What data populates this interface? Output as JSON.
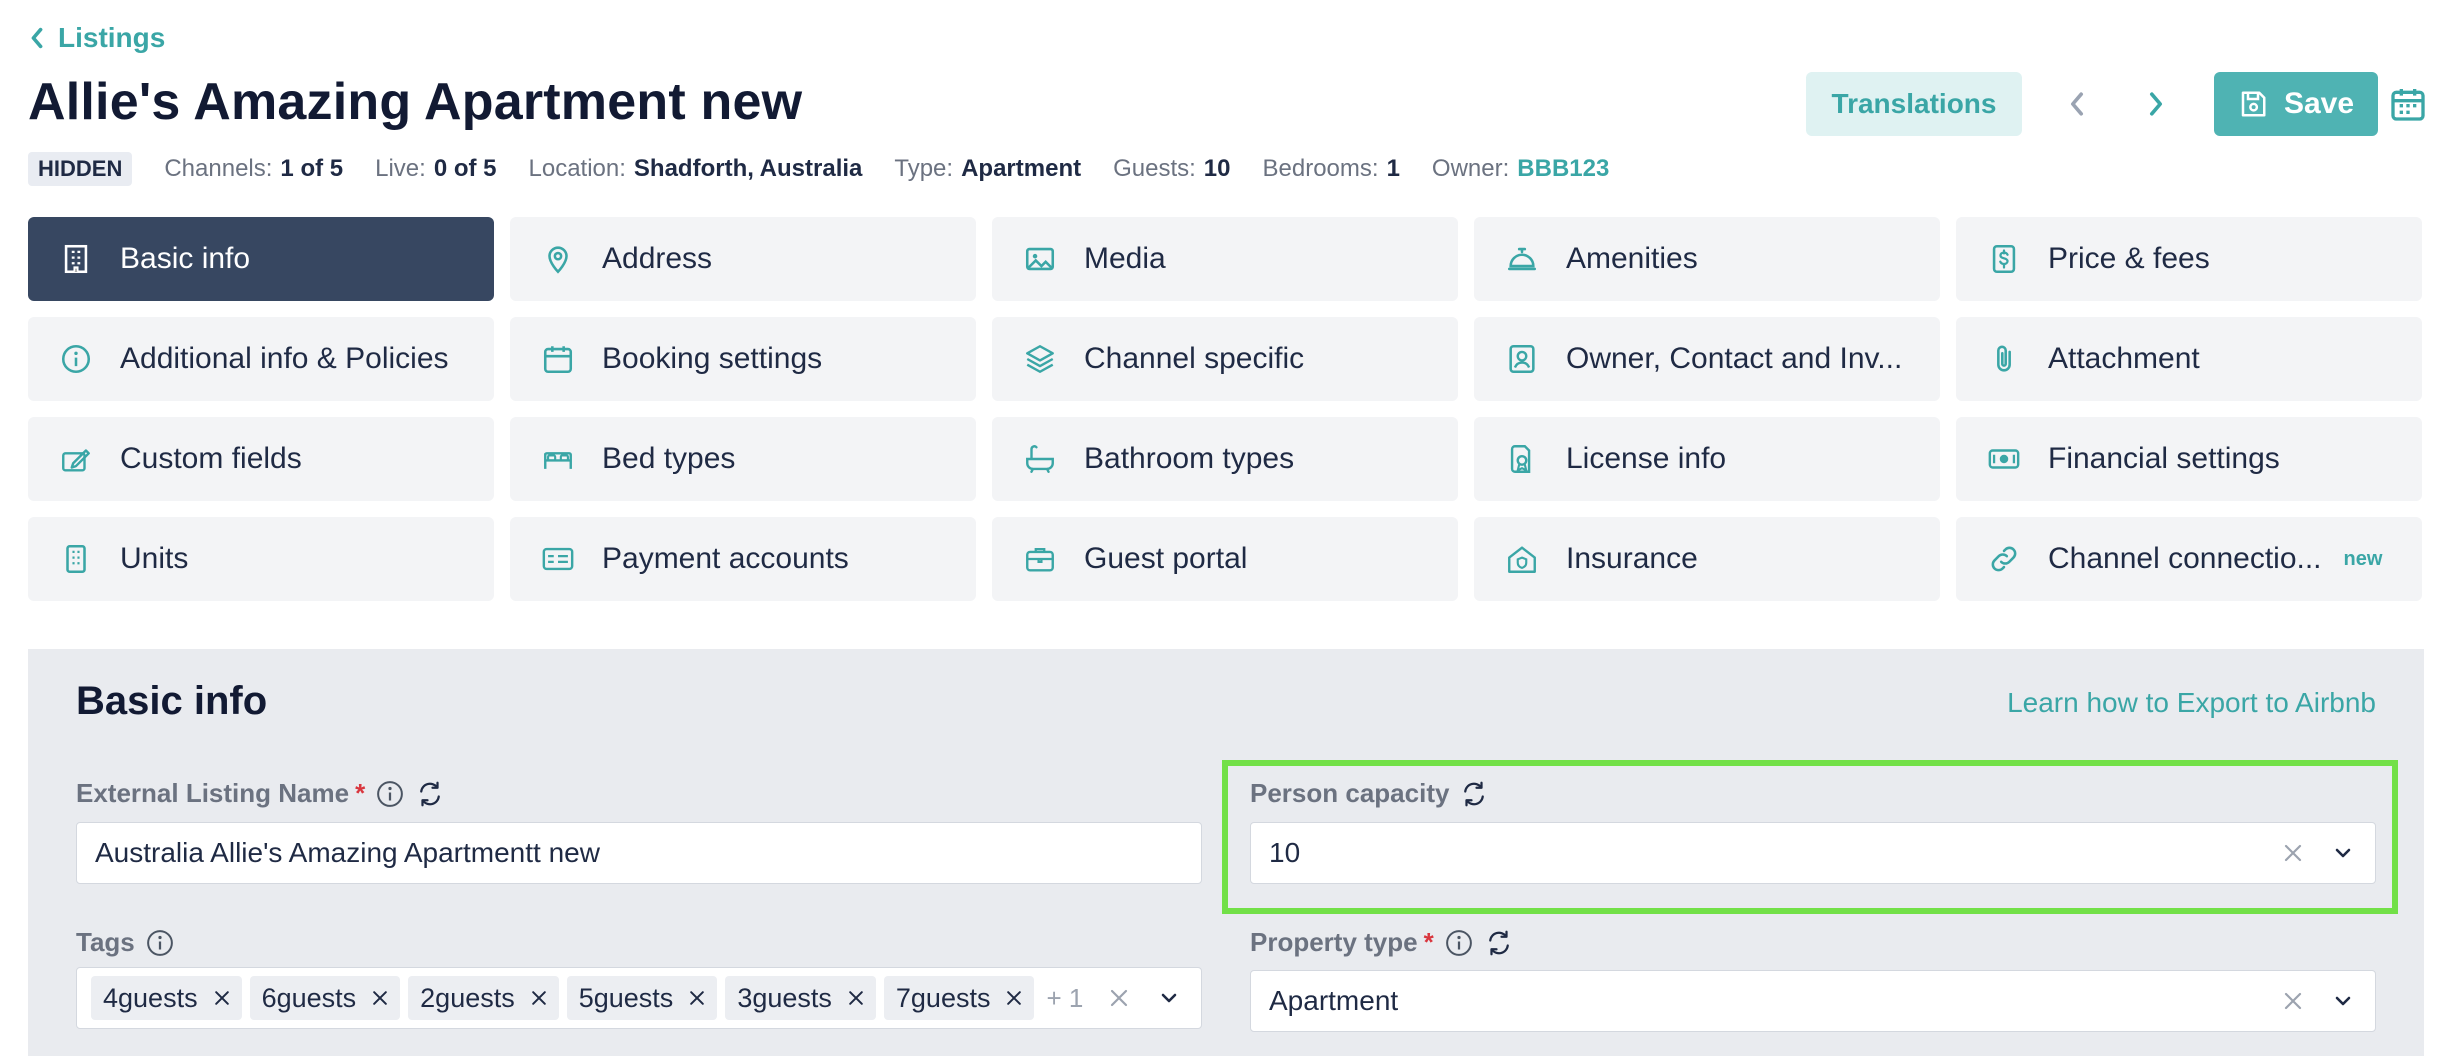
{
  "header": {
    "back_label": "Listings",
    "title": "Allie's Amazing Apartment new",
    "status_badge": "HIDDEN",
    "meta": {
      "channels_label": "Channels:",
      "channels_value": "1 of 5",
      "live_label": "Live:",
      "live_value": "0 of 5",
      "location_label": "Location:",
      "location_value": "Shadforth, Australia",
      "type_label": "Type:",
      "type_value": "Apartment",
      "guests_label": "Guests:",
      "guests_value": "10",
      "bedrooms_label": "Bedrooms:",
      "bedrooms_value": "1",
      "owner_label": "Owner:",
      "owner_value": "BBB123"
    },
    "translations_label": "Translations",
    "save_label": "Save"
  },
  "tabs": [
    {
      "label": "Basic info",
      "icon": "building-icon",
      "active": true
    },
    {
      "label": "Address",
      "icon": "map-pin-icon"
    },
    {
      "label": "Media",
      "icon": "image-icon"
    },
    {
      "label": "Amenities",
      "icon": "service-bell-icon"
    },
    {
      "label": "Price & fees",
      "icon": "dollar-icon"
    },
    {
      "label": "Additional info & Policies",
      "icon": "info-icon"
    },
    {
      "label": "Booking settings",
      "icon": "calendar-icon"
    },
    {
      "label": "Channel specific",
      "icon": "layers-icon"
    },
    {
      "label": "Owner, Contact and Inv...",
      "icon": "contact-icon"
    },
    {
      "label": "Attachment",
      "icon": "paperclip-icon"
    },
    {
      "label": "Custom fields",
      "icon": "edit-icon"
    },
    {
      "label": "Bed types",
      "icon": "bed-icon"
    },
    {
      "label": "Bathroom types",
      "icon": "bathtub-icon"
    },
    {
      "label": "License info",
      "icon": "license-icon"
    },
    {
      "label": "Financial settings",
      "icon": "banknote-icon"
    },
    {
      "label": "Units",
      "icon": "apartment-icon"
    },
    {
      "label": "Payment accounts",
      "icon": "payment-card-icon"
    },
    {
      "label": "Guest portal",
      "icon": "briefcase-icon"
    },
    {
      "label": "Insurance",
      "icon": "home-shield-icon"
    },
    {
      "label": "Channel connectio...",
      "icon": "link-icon",
      "badge": "new"
    }
  ],
  "form": {
    "section_title": "Basic info",
    "learn_link": "Learn how to Export to Airbnb",
    "external_listing_name": {
      "label": "External Listing Name",
      "required_mark": "*",
      "value": "Australia Allie's Amazing Apartmentt new"
    },
    "person_capacity": {
      "label": "Person capacity",
      "value": "10"
    },
    "tags": {
      "label": "Tags",
      "items": [
        "4guests",
        "6guests",
        "2guests",
        "5guests",
        "3guests",
        "7guests"
      ],
      "more": "+ 1"
    },
    "property_type": {
      "label": "Property type",
      "required_mark": "*",
      "value": "Apartment"
    }
  },
  "colors": {
    "accent": "#3aa6a6",
    "save_bg": "#4fb3b3",
    "active_tab": "#374761",
    "highlight": "#72e048",
    "required": "#d9363e"
  }
}
